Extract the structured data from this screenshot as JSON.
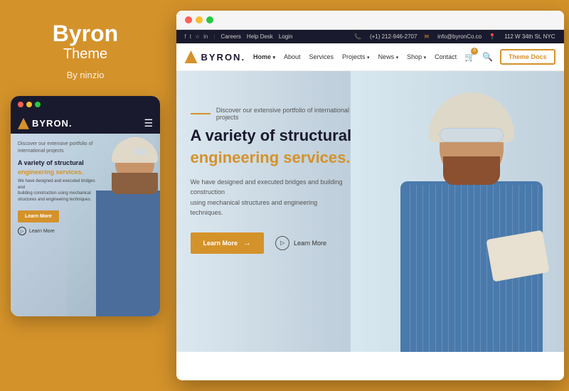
{
  "left": {
    "title": "Byron",
    "subtitle": "Theme",
    "author": "By ninzio",
    "mobile_preview": {
      "logo_text": "BYRON.",
      "tagline": "Discover our extensive portfolio of\ninternational projects",
      "heading": "A variety of structural",
      "heading_accent": "engineering services.",
      "description": "We have designed and executed bridges and\nbuilding construction using mechanical\nstructures and engineering techniques.",
      "cta_primary": "Learn More",
      "cta_secondary": "Learn More"
    }
  },
  "right": {
    "desktop_preview": {
      "topbar": {
        "socials": [
          "f",
          "t",
          "in",
          "in"
        ],
        "links": [
          "Careers",
          "Help Desk",
          "Login"
        ],
        "phone": "(+1) 212-946-2707",
        "email": "info@byronCo.co",
        "address": "112 W 34th St, NYC"
      },
      "logo_text": "BYRON.",
      "nav_links": [
        "Home",
        "About",
        "Services",
        "Projects",
        "News",
        "Shop",
        "Contact"
      ],
      "docs_btn": "Theme Docs",
      "hero": {
        "tagline": "Discover our extensive portfolio of international projects",
        "heading_line1": "A variety of structural",
        "heading_line2": "engineering services.",
        "description": "We have designed and executed bridges and building construction\nusing mechanical structures and engineering techniques.",
        "cta_primary": "Learn More",
        "cta_secondary": "Learn More"
      }
    }
  },
  "colors": {
    "accent": "#D4922A",
    "dark_navy": "#1a1a2e",
    "white": "#ffffff"
  }
}
